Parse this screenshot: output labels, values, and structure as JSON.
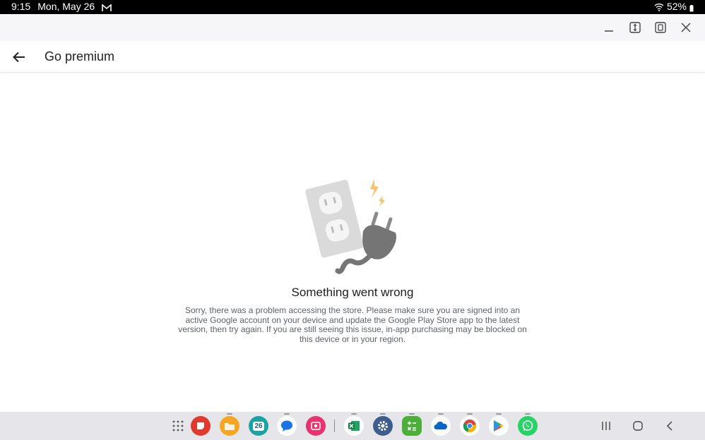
{
  "status_bar": {
    "time": "9:15",
    "date": "Mon, May 26",
    "battery": "52%",
    "icons": [
      "gmail-icon",
      "wifi-icon",
      "battery-icon"
    ]
  },
  "window_controls": [
    "minimize-icon",
    "split-screen-icon",
    "popup-view-icon",
    "close-icon"
  ],
  "app_bar": {
    "title": "Go premium",
    "back_icon": "arrow-left-icon"
  },
  "error": {
    "illustration": "unplugged-outlet-illustration",
    "title": "Something went wrong",
    "message": "Sorry, there was a problem accessing the store. Please make sure you are signed into an active Google account on your device and update the Google Play Store app to the latest version, then try again. If you are still seeing this issue, in-app purchasing may be blocked on this device or in your region."
  },
  "taskbar": {
    "apps_button_icon": "apps-grid-icon",
    "apps": [
      {
        "name": "sticky-notes",
        "color": "#e03a2f",
        "running": false
      },
      {
        "name": "my-files",
        "color": "#f5a623",
        "running": true
      },
      {
        "name": "calendar",
        "color": "#1aa3a3",
        "label": "26",
        "running": false
      },
      {
        "name": "messages",
        "color": "#ffffff",
        "running": true
      },
      {
        "name": "screen-recorder",
        "color": "#e8336e",
        "running": false
      },
      {
        "name": "excel",
        "color": "#ffffff",
        "running": true
      },
      {
        "name": "settings",
        "color": "#3f5d8c",
        "running": true
      },
      {
        "name": "calculator",
        "color": "#4caf3a",
        "running": true
      },
      {
        "name": "onedrive",
        "color": "#ffffff",
        "running": true
      },
      {
        "name": "chrome",
        "color": "#ffffff",
        "running": true
      },
      {
        "name": "play-store",
        "color": "#ffffff",
        "running": true
      },
      {
        "name": "whatsapp",
        "color": "#25d366",
        "running": true
      }
    ],
    "nav": [
      "recents-icon",
      "home-icon",
      "back-icon"
    ]
  }
}
